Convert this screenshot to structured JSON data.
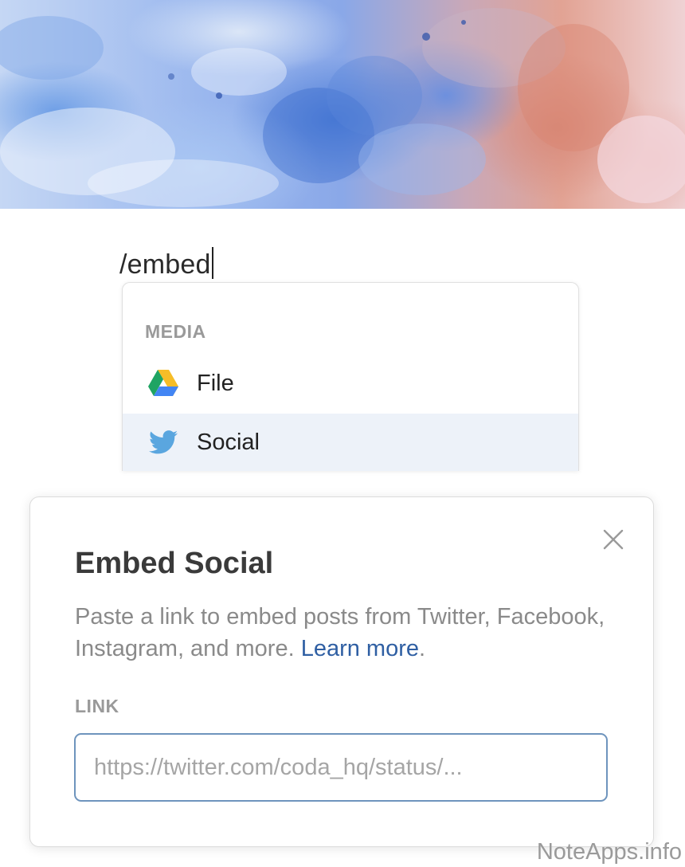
{
  "editor": {
    "typed_text": "/embed"
  },
  "slash_menu": {
    "section_title": "MEDIA",
    "items": [
      {
        "label": "File",
        "icon": "google-drive-icon",
        "selected": false
      },
      {
        "label": "Social",
        "icon": "twitter-bird-icon",
        "selected": true
      }
    ]
  },
  "modal": {
    "title": "Embed Social",
    "description": "Paste a link to embed posts from Twitter, Facebook, Instagram, and more.",
    "learn_more": "Learn more",
    "trailing_period": ".",
    "field_label": "LINK",
    "input_placeholder": "https://twitter.com/coda_hq/status/...",
    "input_value": "",
    "close_icon": "close-icon"
  },
  "watermark": "NoteApps.info",
  "colors": {
    "link_blue": "#2f5fa3",
    "input_border": "#6e94bd",
    "selected_row": "#edf2f9",
    "twitter_blue": "#5aa6df"
  }
}
